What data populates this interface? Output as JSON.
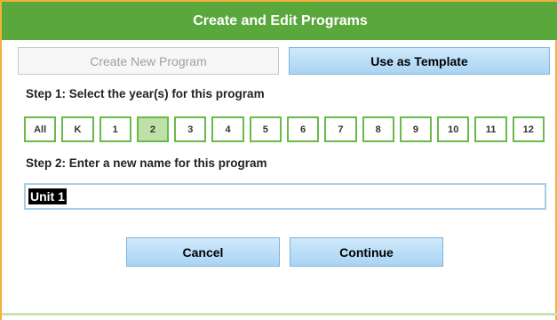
{
  "dialog": {
    "title": "Create and Edit Programs",
    "tabs": {
      "create_new": "Create New Program",
      "use_template": "Use as Template"
    },
    "step1_label": "Step 1: Select the year(s) for this program",
    "years": [
      "All",
      "K",
      "1",
      "2",
      "3",
      "4",
      "5",
      "6",
      "7",
      "8",
      "9",
      "10",
      "11",
      "12"
    ],
    "selected_year": "2",
    "step2_label": "Step 2: Enter a new name for this program",
    "program_name": "Unit 1",
    "buttons": {
      "cancel": "Cancel",
      "continue": "Continue"
    },
    "colors": {
      "header_bg": "#5aa73c",
      "border_orange": "#f2b13a",
      "button_blue": "#a9d4f3",
      "year_selected": "#bfe0a8"
    }
  }
}
